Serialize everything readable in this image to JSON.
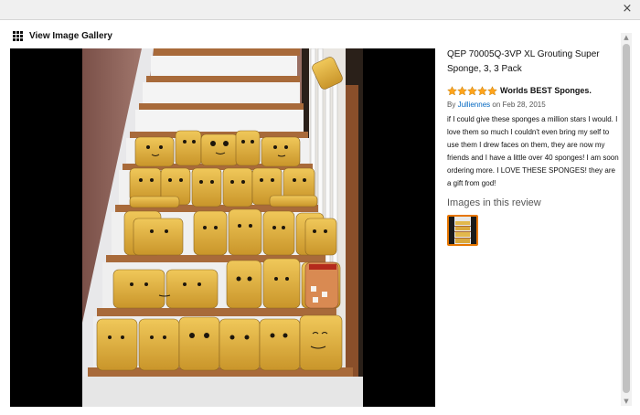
{
  "window": {
    "close_glyph": "×"
  },
  "gallery_link": {
    "label": "View Image Gallery",
    "icon": "grid-icon"
  },
  "product": {
    "title": "QEP 70005Q-3VP XL Grouting Super Sponge, 3, 3 Pack"
  },
  "review": {
    "stars": 5,
    "star_color": "#ffa41c",
    "title": "Worlds BEST Sponges.",
    "by_prefix": "By",
    "author": "Julliennes",
    "date_text": "on Feb 28, 2015",
    "body": "if I could give these sponges a million stars I would. I love them so much I couldn't even bring my self to use them I drew faces on them, they are now my friends and I have a little over 40 sponges! I am soon ordering more. I LOVE THESE SPONGES! they are a gift from god!"
  },
  "images_section": {
    "heading": "Images in this review"
  },
  "colors": {
    "link": "#0066c0",
    "thumb_border": "#e77600",
    "viewer_bg": "#000000"
  }
}
